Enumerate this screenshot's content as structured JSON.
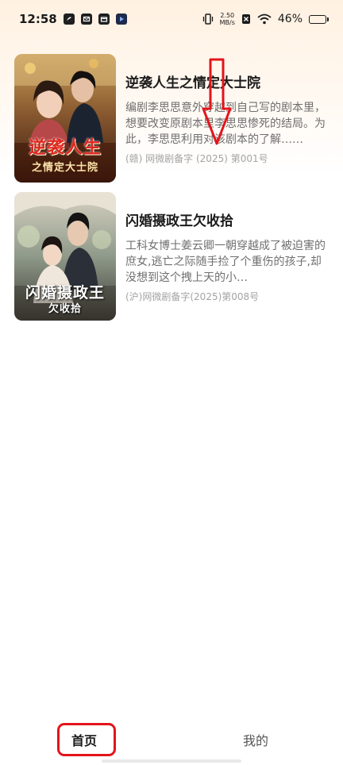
{
  "status_bar": {
    "time": "12:58",
    "net_speed_value": "2.50",
    "net_speed_unit": "MB/s",
    "battery_text": "46%",
    "battery_level": 0.46
  },
  "dramas": [
    {
      "title": "逆袭人生之情定大士院",
      "description": "编剧李思思意外穿越到自己写的剧本里，想要改变原剧本里李思思惨死的结局。为此，李思思利用对该剧本的了解……",
      "record": "(赣) 网微剧备字 (2025) 第001号",
      "poster_main": "逆袭人生",
      "poster_sub": "之情定大士院"
    },
    {
      "title": "闪婚摄政王欠收拾",
      "description": "工科女博士姜云卿一朝穿越成了被迫害的庶女,逃亡之际随手捡了个重伤的孩子,却没想到这个拽上天的小…",
      "record": "(沪)网微剧备字(2025)第008号",
      "poster_main": "闪婚摄政王",
      "poster_sub": "欠收拾"
    }
  ],
  "tabs": {
    "home": "首页",
    "mine": "我的"
  },
  "colors": {
    "annotation_red": "#e3141b",
    "accent_bg": "#fff1e1"
  }
}
